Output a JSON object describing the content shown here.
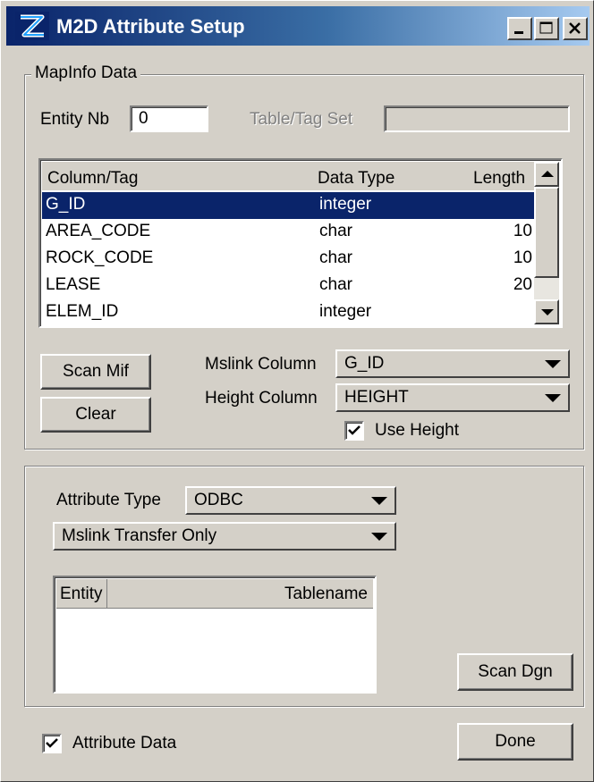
{
  "window": {
    "title": "M2D Attribute Setup"
  },
  "mapinfo": {
    "group_label": "MapInfo Data",
    "entity_nb_label": "Entity Nb",
    "entity_nb_value": "0",
    "table_tag_label": "Table/Tag Set",
    "table_tag_value": "",
    "columns": [
      "Column/Tag",
      "Data Type",
      "Length"
    ],
    "rows": [
      {
        "name": "G_ID",
        "type": "integer",
        "length": ""
      },
      {
        "name": "AREA_CODE",
        "type": "char",
        "length": "10"
      },
      {
        "name": "ROCK_CODE",
        "type": "char",
        "length": "10"
      },
      {
        "name": "LEASE",
        "type": "char",
        "length": "20"
      },
      {
        "name": "ELEM_ID",
        "type": "integer",
        "length": ""
      }
    ],
    "scan_mif_label": "Scan Mif",
    "clear_label": "Clear",
    "mslink_label": "Mslink Column",
    "mslink_value": "G_ID",
    "height_label": "Height Column",
    "height_value": "HEIGHT",
    "use_height_label": "Use Height",
    "use_height_checked": true
  },
  "attribute": {
    "type_label": "Attribute Type",
    "type_value": "ODBC",
    "transfer_value": "Mslink Transfer Only",
    "entity_col": "Entity",
    "tablename_col": "Tablename",
    "scan_dgn_label": "Scan Dgn"
  },
  "footer": {
    "attribute_data_label": "Attribute Data",
    "attribute_data_checked": true,
    "done_label": "Done"
  },
  "colors": {
    "title_start": "#0a246a",
    "title_end": "#a6caf0",
    "selection": "#0a246a",
    "face": "#d4d0c8"
  }
}
